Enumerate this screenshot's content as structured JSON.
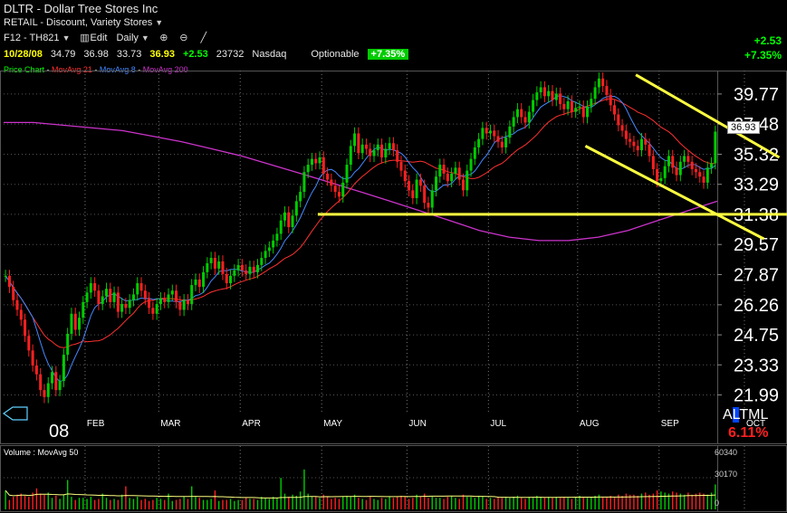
{
  "header": {
    "title": "DLTR - Dollar Tree Stores Inc",
    "industry": "RETAIL - Discount, Variety Stores",
    "window_id": "F12 - TH821",
    "edit_label": "Edit",
    "period": "Daily",
    "quote": {
      "date": "10/28/08",
      "open": "34.79",
      "high": "36.98",
      "low": "33.73",
      "close": "36.93",
      "change": "+2.53",
      "volume": "23732",
      "exchange": "Nasdaq",
      "optionable": "Optionable",
      "pct_change": "+7.35%"
    },
    "right_change": "+2.53",
    "right_pct": "+7.35%"
  },
  "legend": {
    "price": "Price Chart",
    "ma21": "MovAvg 21",
    "ma8": "MovAvg 8",
    "ma200": "MovAvg 200",
    "colors": {
      "price": "#00ff00",
      "ma21": "#ff3030",
      "ma8": "#4488ff",
      "ma200": "#cc33cc"
    }
  },
  "price_tag": "36.93",
  "altml": {
    "a": "A",
    "l": "L",
    "rest": "TML"
  },
  "altml_pct": "6.11%",
  "volume_panel": {
    "label": "Volume : MovAvg 50",
    "ticks": [
      "60340",
      "30170",
      "0"
    ]
  },
  "chart_data": {
    "type": "candlestick",
    "ticker": "DLTR",
    "y_ticks": [
      "39.77",
      "37.48",
      "35.32",
      "33.29",
      "31.38",
      "29.57",
      "27.87",
      "26.26",
      "24.75",
      "23.33",
      "21.99"
    ],
    "ylim": [
      21.2,
      41.5
    ],
    "scale": "log",
    "x_labels": [
      "08",
      "FEB",
      "MAR",
      "APR",
      "MAY",
      "JUN",
      "JUL",
      "AUG",
      "SEP",
      "OCT"
    ],
    "x_label_positions_trading_days": [
      0,
      21,
      40,
      61,
      82,
      104,
      125,
      148,
      169,
      191
    ],
    "closes": [
      27.8,
      27.2,
      26.5,
      26.0,
      25.5,
      24.7,
      24.0,
      23.3,
      22.9,
      22.2,
      21.9,
      22.5,
      23.0,
      22.2,
      22.6,
      23.8,
      24.8,
      25.8,
      25.0,
      25.6,
      26.4,
      26.9,
      27.4,
      27.0,
      26.3,
      26.7,
      27.1,
      26.4,
      26.9,
      25.9,
      26.3,
      26.1,
      26.5,
      26.8,
      27.4,
      27.0,
      26.6,
      26.1,
      25.8,
      26.3,
      26.6,
      26.4,
      26.8,
      27.0,
      26.4,
      26.0,
      26.5,
      26.3,
      27.3,
      27.6,
      27.2,
      28.0,
      28.5,
      28.8,
      28.2,
      28.6,
      27.9,
      27.4,
      27.8,
      28.1,
      28.4,
      28.1,
      27.9,
      28.3,
      28.0,
      28.4,
      28.8,
      29.2,
      29.4,
      29.8,
      30.2,
      31.0,
      31.5,
      30.6,
      31.3,
      32.2,
      32.8,
      34.1,
      34.6,
      35.0,
      34.7,
      35.1,
      34.0,
      33.6,
      33.2,
      32.8,
      32.5,
      33.4,
      34.6,
      35.9,
      36.8,
      35.4,
      36.0,
      35.7,
      35.2,
      35.6,
      36.0,
      35.1,
      35.7,
      36.1,
      35.6,
      34.8,
      34.2,
      33.5,
      32.9,
      32.4,
      33.6,
      33.2,
      32.1,
      31.8,
      32.9,
      33.8,
      34.6,
      34.0,
      33.5,
      34.0,
      34.4,
      33.6,
      32.9,
      34.2,
      35.0,
      35.8,
      36.4,
      37.2,
      36.8,
      37.0,
      36.6,
      36.2,
      35.8,
      36.5,
      37.3,
      38.0,
      38.6,
      38.0,
      37.6,
      38.4,
      39.3,
      39.9,
      40.3,
      39.6,
      40.0,
      39.3,
      39.8,
      39.0,
      38.6,
      39.2,
      38.4,
      38.7,
      38.8,
      38.0,
      38.8,
      39.4,
      40.3,
      41.0,
      40.4,
      39.7,
      38.9,
      38.2,
      37.4,
      37.0,
      36.4,
      36.2,
      35.9,
      35.6,
      36.4,
      36.0,
      35.2,
      34.3,
      33.5,
      33.7,
      34.5,
      35.2,
      34.4,
      33.9,
      34.8,
      35.2,
      34.8,
      34.3,
      34.1,
      33.8,
      33.4,
      34.4,
      34.7,
      36.93
    ],
    "volume": [
      18000,
      9000,
      12000,
      14000,
      15000,
      13000,
      12000,
      16000,
      20000,
      15000,
      14000,
      16000,
      11000,
      13000,
      10000,
      14000,
      28000,
      12000,
      9000,
      11000,
      11000,
      10000,
      12000,
      9000,
      10000,
      15000,
      11000,
      9000,
      10000,
      9000,
      14000,
      22000,
      11000,
      10000,
      12000,
      9000,
      10000,
      8000,
      9000,
      11000,
      10000,
      9000,
      15000,
      8000,
      9000,
      10000,
      12000,
      10000,
      22000,
      12000,
      11000,
      9000,
      9000,
      10000,
      18000,
      8000,
      9000,
      9000,
      10000,
      8000,
      9000,
      9000,
      11000,
      10000,
      10000,
      9000,
      12000,
      11000,
      10000,
      12000,
      11000,
      30000,
      15000,
      12000,
      14000,
      13000,
      17000,
      38000,
      15000,
      12000,
      12000,
      11000,
      14000,
      12000,
      10000,
      11000,
      10000,
      12000,
      13000,
      12000,
      14000,
      11000,
      10000,
      9000,
      12000,
      10000,
      9000,
      11000,
      10000,
      12000,
      11000,
      12000,
      13000,
      12000,
      10000,
      11000,
      14000,
      12000,
      15000,
      11000,
      12000,
      11000,
      11000,
      10000,
      12000,
      13000,
      11000,
      10000,
      14000,
      12000,
      12000,
      11000,
      13000,
      12000,
      10000,
      11000,
      10000,
      12000,
      11000,
      12000,
      11000,
      12000,
      13000,
      11000,
      10000,
      12000,
      11000,
      13000,
      12000,
      11000,
      12000,
      11000,
      12000,
      11000,
      12000,
      11000,
      10000,
      12000,
      13000,
      12000,
      11000,
      12000,
      13000,
      14000,
      12000,
      12000,
      13000,
      12000,
      14000,
      13000,
      15000,
      14000,
      14000,
      13000,
      15000,
      16000,
      14000,
      15000,
      18000,
      17000,
      16000,
      15000,
      17000,
      16000,
      15000,
      14000,
      16000,
      14000,
      15000,
      16000,
      15000,
      14000,
      16000,
      23732
    ],
    "volume_ylim": [
      0,
      60340
    ],
    "overlays": [
      {
        "name": "MovAvg 21",
        "color": "#ff3030"
      },
      {
        "name": "MovAvg 8",
        "color": "#4488ff"
      },
      {
        "name": "MovAvg 200",
        "color": "#cc33cc"
      }
    ],
    "ma200_path": [
      37.6,
      37.6,
      37.4,
      37.2,
      37.0,
      36.6,
      36.2,
      35.7,
      35.2,
      34.6,
      34.0,
      33.4,
      32.8,
      32.2,
      31.6,
      31.0,
      30.4,
      30.0,
      29.8,
      29.8,
      30.0,
      30.4,
      31.0,
      31.6,
      32.2
    ],
    "drawn_lines": [
      {
        "name": "support",
        "color": "#ffff40",
        "points": [
          [
            81,
            31.38
          ],
          [
            204,
            31.38
          ]
        ]
      },
      {
        "name": "channel-upper",
        "color": "#ffff40",
        "points": [
          [
            163,
            41.3
          ],
          [
            200,
            35.1
          ]
        ]
      },
      {
        "name": "channel-lower",
        "color": "#ffff40",
        "points": [
          [
            150,
            35.9
          ],
          [
            196,
            29.9
          ]
        ]
      }
    ]
  }
}
